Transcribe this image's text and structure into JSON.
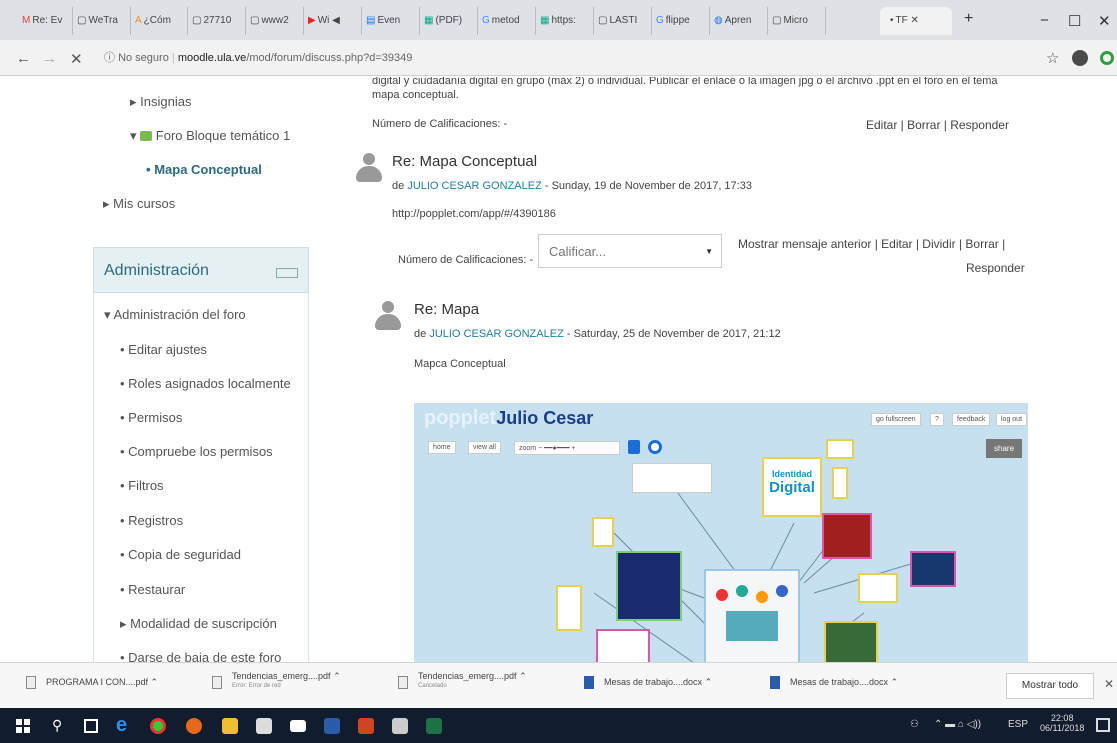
{
  "browser": {
    "tabs": [
      {
        "icon": "M",
        "title": "Re: Ev"
      },
      {
        "icon": "▢",
        "title": "WeTra"
      },
      {
        "icon": "A",
        "title": "¿Cóm"
      },
      {
        "icon": "▢",
        "title": "27710"
      },
      {
        "icon": "▢",
        "title": "www2"
      },
      {
        "icon": "▶",
        "title": "Wi ◀"
      },
      {
        "icon": "▤",
        "title": "Even"
      },
      {
        "icon": "▦",
        "title": "(PDF)"
      },
      {
        "icon": "G",
        "title": "metod"
      },
      {
        "icon": "▦",
        "title": "https:"
      },
      {
        "icon": "▢",
        "title": "LASTI"
      },
      {
        "icon": "G",
        "title": "flippe"
      },
      {
        "icon": "◍",
        "title": "Apren"
      },
      {
        "icon": "▢",
        "title": "Micro"
      },
      {
        "icon": "•",
        "title": "TF"
      }
    ],
    "new_tab": "+",
    "window_controls": {
      "minimize": "−",
      "maximize": "☐",
      "close": "✕"
    },
    "url_prefix": "No seguro",
    "url_host": "moodle.ula.ve",
    "url_path": "/mod/forum/discuss.php?d=39349",
    "nav": {
      "back": "←",
      "forward": "→",
      "reload": "✕",
      "info": "ⓘ",
      "star": "☆"
    }
  },
  "sidebar": {
    "nav_items": [
      {
        "label": "Insignias",
        "marker": "▸"
      },
      {
        "label": "Foro Bloque temático 1",
        "marker": "▾"
      },
      {
        "label": "Mapa Conceptual",
        "marker": "•"
      },
      {
        "label": "Mis cursos",
        "marker": "▸"
      }
    ],
    "admin_title": "Administración",
    "admin_section": "Administración del foro",
    "admin_items": [
      "Editar ajustes",
      "Roles asignados localmente",
      "Permisos",
      "Compruebe los permisos",
      "Filtros",
      "Registros",
      "Copia de seguridad",
      "Restaurar",
      "Modalidad de suscripción",
      "Darse de baja de este foro"
    ]
  },
  "main": {
    "top_text_line1": "digital y ciudadanía digital en grupo (máx 2) o individual. Publicar el enlace o la imagen jpg o el archivo .ppt en el foro en el tema",
    "top_text_line2": "mapa conceptual.",
    "top_ratings_label": "Número de Calificaciones: -",
    "top_actions": "Editar | Borrar | Responder",
    "post1": {
      "title": "Re: Mapa Conceptual",
      "author_prefix": "de",
      "author": "JULIO CESAR GONZALEZ",
      "date": "- Sunday, 19 de November de 2017, 17:33",
      "body": "http://popplet.com/app/#/4390186",
      "ratings_label": "Número de Calificaciones: -",
      "select_value": "Calificar...",
      "actions_line1": "Mostrar mensaje anterior | Editar | Dividir | Borrar |",
      "actions_line2": "Responder"
    },
    "post2": {
      "title": "Re: Mapa",
      "author_prefix": "de",
      "author": "JULIO CESAR GONZALEZ",
      "date": "- Saturday, 25 de November de 2017, 21:12",
      "body": "Mapca Conceptual"
    },
    "popplet": {
      "brand": "popplet",
      "name": "Julio Cesar",
      "toolbar": [
        "home",
        "view all",
        "zoom"
      ],
      "top_buttons": [
        "go fullscreen",
        "?",
        "feedback",
        "log out"
      ],
      "share": "share",
      "digital_identity_line1": "Identidad",
      "digital_identity_line2": "Digital"
    }
  },
  "downloads": {
    "items": [
      {
        "name": "PROGRAMA I CON....pdf",
        "sub": ""
      },
      {
        "name": "Tendencias_emerg....pdf",
        "sub": "Error: Error de red"
      },
      {
        "name": "Tendencias_emerg....pdf",
        "sub": "Cancelado"
      },
      {
        "name": "Mesas de trabajo....docx",
        "sub": ""
      },
      {
        "name": "Mesas de trabajo....docx",
        "sub": ""
      }
    ],
    "show_all": "Mostrar todo",
    "close": "✕"
  },
  "taskbar": {
    "lang": "ESP",
    "time": "22:08",
    "date": "06/11/2018"
  },
  "colors": {
    "link": "#1f7fa6",
    "active_item": "#2b6b7d",
    "admin_header_bg": "#e5f0f3",
    "popplet_bg": "#c7e0f0",
    "taskbar": "#111c2e"
  }
}
